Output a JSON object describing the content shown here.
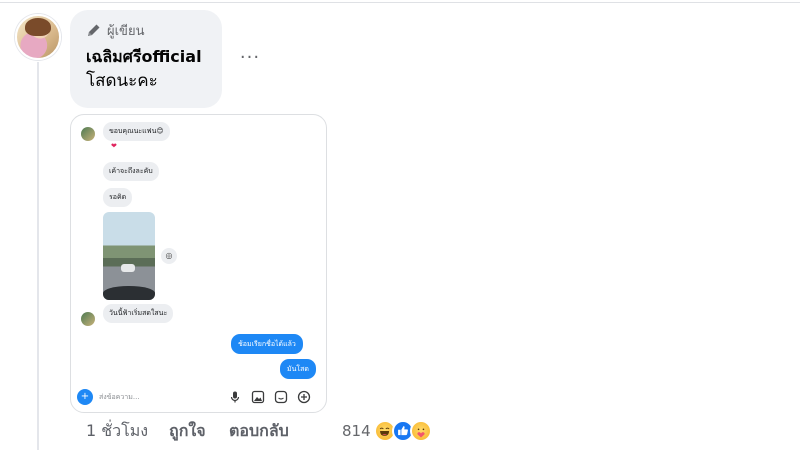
{
  "comment": {
    "author_badge": "ผู้เขียน",
    "author_name": "เฉลิมศรีofficial",
    "text": "โสดนะคะ",
    "more_label": "···"
  },
  "screenshot": {
    "messages_in": [
      "ขอบคุณนะแฟน😊",
      "เค้าจะถึงละคับ",
      "รอคิด",
      "วันนี้ฟ้าเริ่มสดใสนะ"
    ],
    "heart": "❤",
    "messages_out": [
      "ช้อมเรียกชื่อได้แล้ว",
      "มันโสด"
    ],
    "composer_placeholder": "ส่งข้อความ...",
    "composer_plus": "+"
  },
  "actions": {
    "time": "1 ชั่วโมง",
    "like": "ถูกใจ",
    "reply": "ตอบกลับ",
    "reaction_count": "814",
    "reactions": [
      "haha",
      "like",
      "care"
    ]
  },
  "colors": {
    "bubble_bg": "#f0f2f5",
    "outgoing_bubble": "#1e88f5",
    "like_blue": "#1877f2",
    "meta_text": "#65676b"
  }
}
